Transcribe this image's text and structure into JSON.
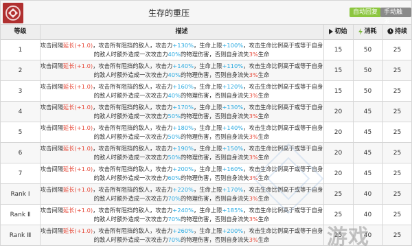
{
  "header": {
    "title": "生存的重压",
    "badge_auto": "自动回复",
    "badge_manual": "手动触发"
  },
  "columns": {
    "level": "等级",
    "desc": "描述",
    "initial": "初始",
    "cost": "消耗",
    "duration": "持续"
  },
  "desc_text": {
    "p1": "攻击间隔",
    "p2": "，攻击所有阻挡的敌人，攻击力",
    "p3": "，生命上限",
    "p4": "，攻击生命比例高于或等于自身的敌人时额外造成一次攻击力",
    "p5": "的物理伤害，否则自身流失",
    "p6": "生命"
  },
  "rows": [
    {
      "level": "1",
      "interval": "延长(+1.0)",
      "atk": "+130%",
      "hp": "+100%",
      "extra": "40%",
      "loss": "3%",
      "initial": "15",
      "cost": "50",
      "duration": "25"
    },
    {
      "level": "2",
      "interval": "延长(+1.0)",
      "atk": "+140%",
      "hp": "+110%",
      "extra": "40%",
      "loss": "3%",
      "initial": "15",
      "cost": "50",
      "duration": "25"
    },
    {
      "level": "3",
      "interval": "延长(+1.0)",
      "atk": "+160%",
      "hp": "+120%",
      "extra": "40%",
      "loss": "3%",
      "initial": "15",
      "cost": "50",
      "duration": "25"
    },
    {
      "level": "4",
      "interval": "延长(+1.0)",
      "atk": "+170%",
      "hp": "+130%",
      "extra": "50%",
      "loss": "3%",
      "initial": "20",
      "cost": "45",
      "duration": "25"
    },
    {
      "level": "5",
      "interval": "延长(+1.0)",
      "atk": "+180%",
      "hp": "+140%",
      "extra": "50%",
      "loss": "3%",
      "initial": "20",
      "cost": "45",
      "duration": "25"
    },
    {
      "level": "6",
      "interval": "延长(+1.0)",
      "atk": "+190%",
      "hp": "+150%",
      "extra": "50%",
      "loss": "3%",
      "initial": "20",
      "cost": "45",
      "duration": "25"
    },
    {
      "level": "7",
      "interval": "延长(+1.0)",
      "atk": "+200%",
      "hp": "+160%",
      "extra": "60%",
      "loss": "3%",
      "initial": "20",
      "cost": "45",
      "duration": "25"
    },
    {
      "level": "Rank Ⅰ",
      "interval": "延长(+1.0)",
      "atk": "+220%",
      "hp": "+170%",
      "extra": "70%",
      "loss": "3%",
      "initial": "25",
      "cost": "40",
      "duration": "25"
    },
    {
      "level": "Rank Ⅱ",
      "interval": "延长(+1.0)",
      "atk": "+240%",
      "hp": "+185%",
      "extra": "70%",
      "loss": "3%",
      "initial": "25",
      "cost": "40",
      "duration": "25"
    },
    {
      "level": "Rank Ⅲ",
      "interval": "延长(+1.0)",
      "atk": "+260%",
      "hp": "+200%",
      "extra": "70%",
      "loss": "3%",
      "initial": "25",
      "cost": "40",
      "duration": "25"
    }
  ],
  "watermark": "游戏",
  "colors": {
    "badge_auto": "#8cc63f",
    "badge_manual": "#8a8a8a",
    "increase": "#27a9e1",
    "penalty": "#e74c3c"
  },
  "icons": {
    "skill": "skill-icon",
    "initial": "play-triangle-icon",
    "cost": "lightning-bolt-icon",
    "duration": "clock-icon"
  }
}
